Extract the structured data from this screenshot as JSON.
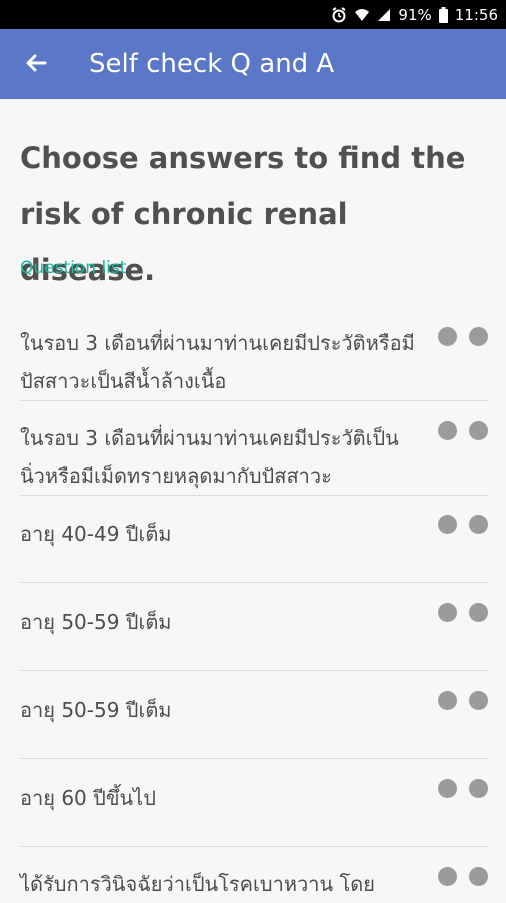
{
  "status": {
    "battery": "91%",
    "time": "11:56"
  },
  "appbar": {
    "title": "Self check Q and A"
  },
  "heading": "Choose answers to find the risk of chronic renal disease.",
  "list_title": "Question list",
  "questions": [
    {
      "text": "ในรอบ 3 เดือนที่ผ่านมาท่านเคยมีประวัติหรือมีปัสสาวะเป็นสีน้ำล้างเนื้อ"
    },
    {
      "text": "ในรอบ 3 เดือนที่ผ่านมาท่านเคยมีประวัติเป็นนิ่วหรือมีเม็ดทรายหลุดมากับปัสสาวะ"
    },
    {
      "text": "อายุ 40-49 ปีเต็ม"
    },
    {
      "text": "อายุ 50-59 ปีเต็ม"
    },
    {
      "text": "อายุ 50-59 ปีเต็ม"
    },
    {
      "text": "อายุ 60 ปีขึ้นไป"
    },
    {
      "text": "ได้รับการวินิจฉัยว่าเป็นโรคเบาหวาน โดย"
    }
  ]
}
